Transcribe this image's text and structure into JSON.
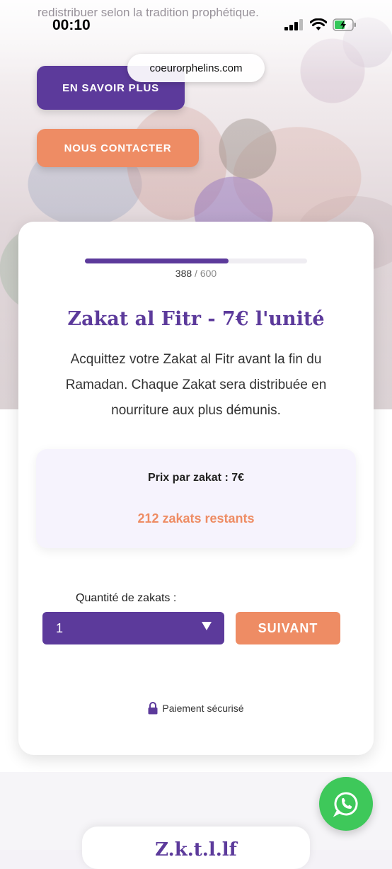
{
  "status_bar": {
    "time": "00:10"
  },
  "browser": {
    "url": "coeurorphelins.com"
  },
  "hero": {
    "intro_text": "redistribuer selon la tradition prophétique.",
    "learn_more_label": "EN SAVOIR PLUS",
    "contact_label": "NOUS CONTACTER"
  },
  "campaign": {
    "progress": {
      "raised": "388",
      "separator": "/",
      "goal": "600",
      "fraction": 0.6467
    },
    "title": "Zakat al Fitr - 7€ l'unité",
    "description": "Acquittez votre Zakat al Fitr avant la fin du Ramadan. Chaque Zakat sera distribuée en nourriture aux plus démunis.",
    "price_label": "Prix par zakat : 7€",
    "remaining_label": "212 zakats restants",
    "quantity_label": "Quantité de zakats :",
    "quantity_value": "1",
    "next_label": "SUIVANT",
    "secure_label": "Paiement sécurisé"
  },
  "next_section": {
    "title_partial": "Z.k.t.l.lf"
  },
  "colors": {
    "primary": "#5c3a9b",
    "accent": "#ee8c64",
    "whatsapp": "#3ec85a"
  },
  "icons": [
    "signal-icon",
    "wifi-icon",
    "battery-charging-icon",
    "lock-icon",
    "whatsapp-icon",
    "chevron-down-icon"
  ]
}
